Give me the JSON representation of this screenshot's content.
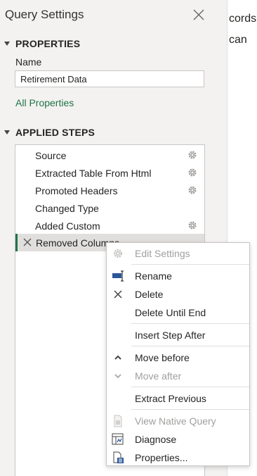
{
  "background": {
    "line1": "cords",
    "line2": "can"
  },
  "panel": {
    "title": "Query Settings"
  },
  "properties": {
    "header": "PROPERTIES",
    "name_label": "Name",
    "name_value": "Retirement Data",
    "all_properties_link": "All Properties"
  },
  "applied_steps": {
    "header": "APPLIED STEPS",
    "items": [
      {
        "label": "Source",
        "has_gear": true
      },
      {
        "label": "Extracted Table From Html",
        "has_gear": true
      },
      {
        "label": "Promoted Headers",
        "has_gear": true
      },
      {
        "label": "Changed Type",
        "has_gear": false
      },
      {
        "label": "Added Custom",
        "has_gear": true
      },
      {
        "label": "Removed Columns",
        "has_gear": false,
        "selected": true
      }
    ]
  },
  "context_menu": {
    "items": [
      {
        "label": "Edit Settings",
        "icon": "gear-icon",
        "disabled": true
      },
      {
        "label": "Rename",
        "icon": "rename-icon",
        "disabled": false
      },
      {
        "label": "Delete",
        "icon": "close-icon",
        "disabled": false
      },
      {
        "label": "Delete Until End",
        "icon": "",
        "disabled": false
      },
      {
        "label": "Insert Step After",
        "icon": "",
        "disabled": false
      },
      {
        "label": "Move before",
        "icon": "chevron-up-icon",
        "disabled": false
      },
      {
        "label": "Move after",
        "icon": "chevron-down-icon",
        "disabled": true
      },
      {
        "label": "Extract Previous",
        "icon": "",
        "disabled": false
      },
      {
        "label": "View Native Query",
        "icon": "native-query-icon",
        "disabled": true
      },
      {
        "label": "Diagnose",
        "icon": "diagnose-icon",
        "disabled": false
      },
      {
        "label": "Properties...",
        "icon": "properties-icon",
        "disabled": false
      }
    ]
  },
  "colors": {
    "accent": "#217346",
    "panel_bg": "#f3f2f1",
    "selected_bg": "#e1dfdd",
    "disabled_text": "#a19f9d"
  }
}
